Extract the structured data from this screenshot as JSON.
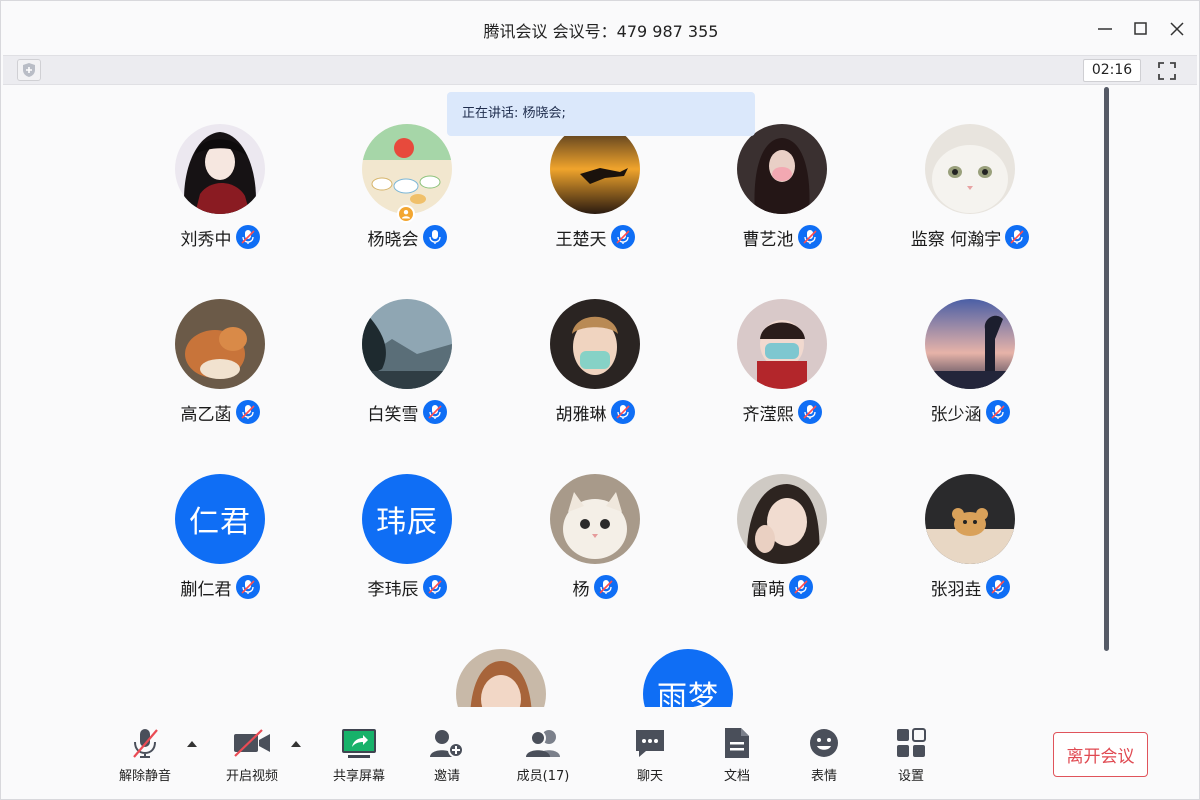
{
  "window": {
    "title": "腾讯会议 会议号：479 987 355"
  },
  "statusbar": {
    "timer": "02:16"
  },
  "speaking_banner": {
    "text": "正在讲话: 杨晓会;"
  },
  "participants": [
    {
      "name": "刘秀中",
      "avatar": "photo",
      "mic": "muted"
    },
    {
      "name": "杨晓会",
      "avatar": "photo",
      "mic": "on",
      "host": true
    },
    {
      "name": "王楚天",
      "avatar": "photo",
      "mic": "muted"
    },
    {
      "name": "曹艺池",
      "avatar": "photo",
      "mic": "muted"
    },
    {
      "name": "监察 何瀚宇",
      "avatar": "photo",
      "mic": "muted"
    },
    {
      "name": "高乙菡",
      "avatar": "photo",
      "mic": "muted"
    },
    {
      "name": "白笑雪",
      "avatar": "photo",
      "mic": "muted"
    },
    {
      "name": "胡雅琳",
      "avatar": "photo",
      "mic": "muted"
    },
    {
      "name": "齐滢熙",
      "avatar": "photo",
      "mic": "muted"
    },
    {
      "name": "张少涵",
      "avatar": "photo",
      "mic": "muted"
    },
    {
      "name": "蒯仁君",
      "avatar": "text",
      "avatar_text": "仁君",
      "mic": "muted"
    },
    {
      "name": "李玮辰",
      "avatar": "text",
      "avatar_text": "玮辰",
      "mic": "muted"
    },
    {
      "name": "杨",
      "avatar": "photo",
      "mic": "muted"
    },
    {
      "name": "雷萌",
      "avatar": "photo",
      "mic": "muted"
    },
    {
      "name": "张羽垚",
      "avatar": "photo",
      "mic": "muted"
    },
    {
      "name": "",
      "avatar": "photo",
      "mic": ""
    },
    {
      "name": "",
      "avatar": "text",
      "avatar_text": "雨梦",
      "mic": ""
    }
  ],
  "toolbar": {
    "unmute": "解除静音",
    "start_video": "开启视频",
    "share_screen": "共享屏幕",
    "invite": "邀请",
    "members": "成员(17)",
    "chat": "聊天",
    "docs": "文档",
    "reactions": "表情",
    "settings": "设置",
    "leave": "离开会议"
  },
  "colors": {
    "accent": "#0f6ef5",
    "leave": "#e04a52",
    "share_green": "#19b65b",
    "speaking_bg": "#dbe8fb"
  }
}
